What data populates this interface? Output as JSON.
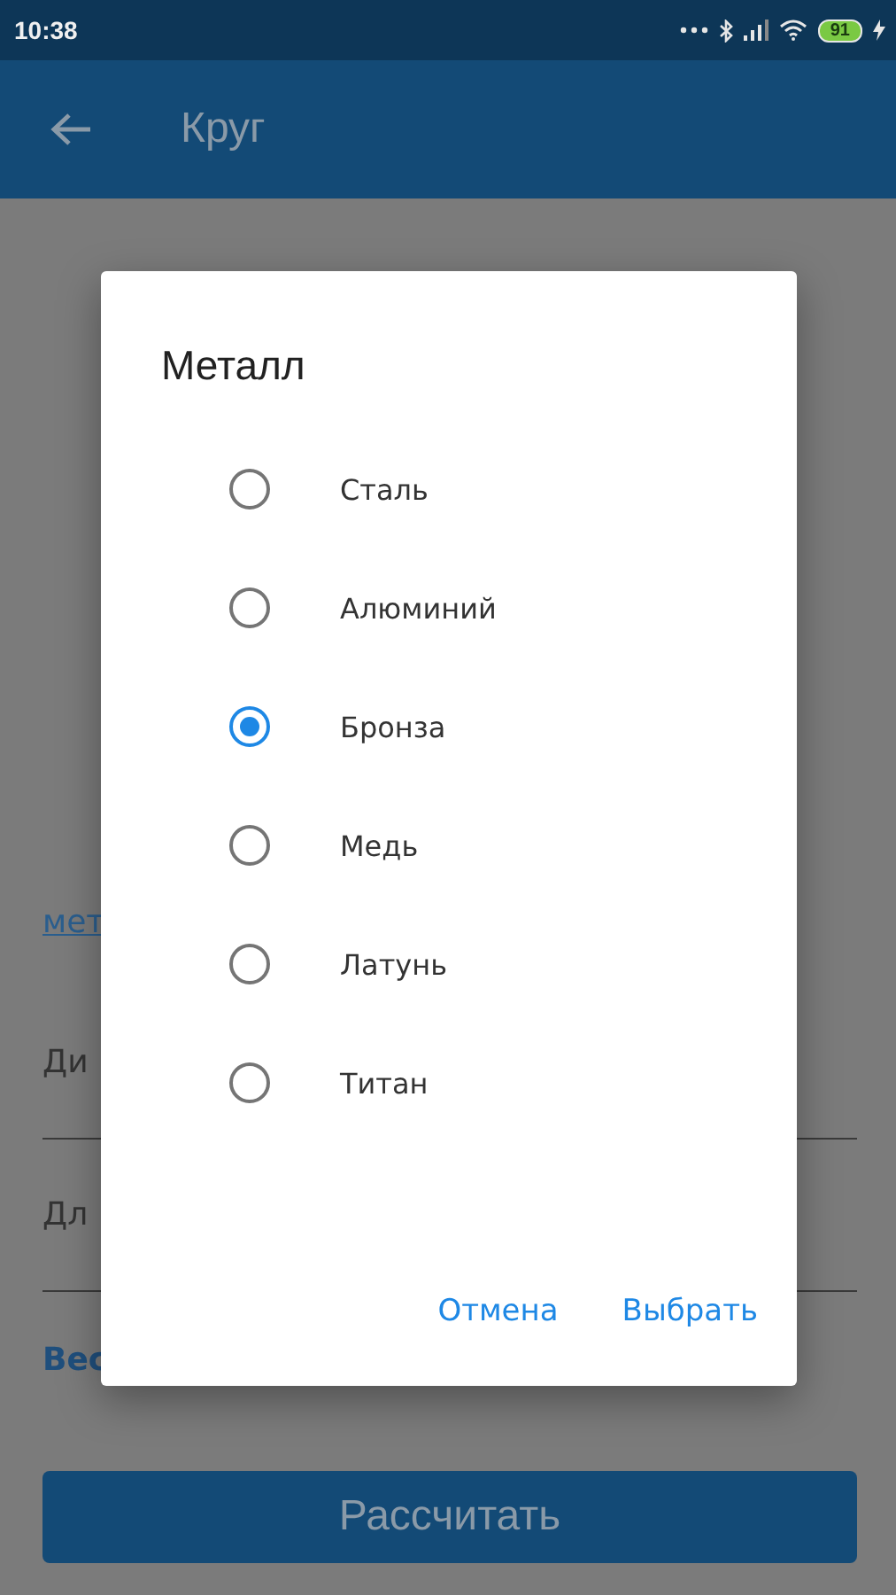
{
  "status_bar": {
    "time": "10:38",
    "battery": "91"
  },
  "app_bar": {
    "title": "Круг"
  },
  "background_form": {
    "link": "мет",
    "fields": [
      {
        "label": "Ди"
      },
      {
        "label": "Дл"
      }
    ],
    "result_label": "Вес",
    "button": "Рассчитать"
  },
  "dialog": {
    "title": "Металл",
    "options": [
      {
        "label": "Сталь",
        "selected": false
      },
      {
        "label": "Алюминий",
        "selected": false
      },
      {
        "label": "Бронза",
        "selected": true
      },
      {
        "label": "Медь",
        "selected": false
      },
      {
        "label": "Латунь",
        "selected": false
      },
      {
        "label": "Титан",
        "selected": false
      }
    ],
    "buttons": [
      "Отмена",
      "Выбрать"
    ]
  }
}
